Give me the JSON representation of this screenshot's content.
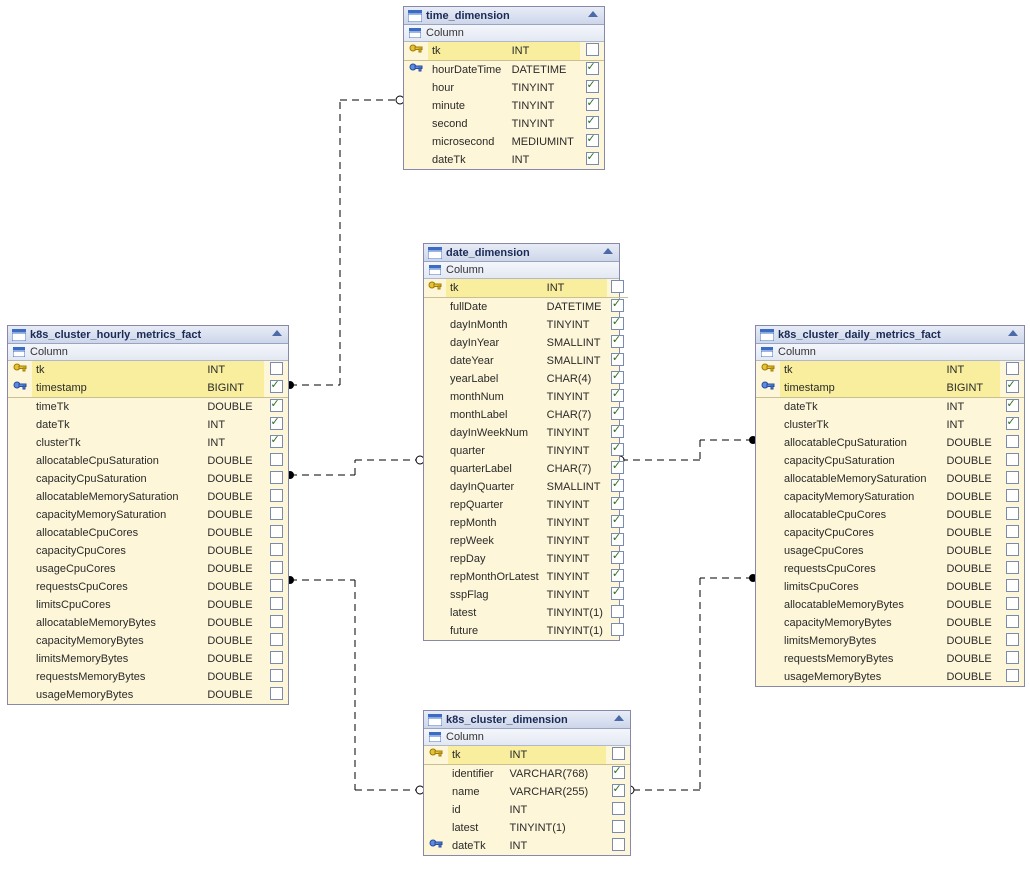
{
  "column_header": "Column",
  "tables": {
    "time_dimension": {
      "title": "time_dimension",
      "cols": [
        {
          "icon": "pk",
          "name": "tk",
          "type": "INT",
          "chk": false
        },
        {
          "icon": "fk",
          "name": "hourDateTime",
          "type": "DATETIME",
          "chk": true
        },
        {
          "icon": "",
          "name": "hour",
          "type": "TINYINT",
          "chk": true
        },
        {
          "icon": "",
          "name": "minute",
          "type": "TINYINT",
          "chk": true
        },
        {
          "icon": "",
          "name": "second",
          "type": "TINYINT",
          "chk": true
        },
        {
          "icon": "",
          "name": "microsecond",
          "type": "MEDIUMINT",
          "chk": true
        },
        {
          "icon": "",
          "name": "dateTk",
          "type": "INT",
          "chk": true
        }
      ]
    },
    "date_dimension": {
      "title": "date_dimension",
      "cols": [
        {
          "icon": "pk",
          "name": "tk",
          "type": "INT",
          "chk": false
        },
        {
          "icon": "",
          "name": "fullDate",
          "type": "DATETIME",
          "chk": true
        },
        {
          "icon": "",
          "name": "dayInMonth",
          "type": "TINYINT",
          "chk": true
        },
        {
          "icon": "",
          "name": "dayInYear",
          "type": "SMALLINT",
          "chk": true
        },
        {
          "icon": "",
          "name": "dateYear",
          "type": "SMALLINT",
          "chk": true
        },
        {
          "icon": "",
          "name": "yearLabel",
          "type": "CHAR(4)",
          "chk": true
        },
        {
          "icon": "",
          "name": "monthNum",
          "type": "TINYINT",
          "chk": true
        },
        {
          "icon": "",
          "name": "monthLabel",
          "type": "CHAR(7)",
          "chk": true
        },
        {
          "icon": "",
          "name": "dayInWeekNum",
          "type": "TINYINT",
          "chk": true
        },
        {
          "icon": "",
          "name": "quarter",
          "type": "TINYINT",
          "chk": true
        },
        {
          "icon": "",
          "name": "quarterLabel",
          "type": "CHAR(7)",
          "chk": true
        },
        {
          "icon": "",
          "name": "dayInQuarter",
          "type": "SMALLINT",
          "chk": true
        },
        {
          "icon": "",
          "name": "repQuarter",
          "type": "TINYINT",
          "chk": true
        },
        {
          "icon": "",
          "name": "repMonth",
          "type": "TINYINT",
          "chk": true
        },
        {
          "icon": "",
          "name": "repWeek",
          "type": "TINYINT",
          "chk": true
        },
        {
          "icon": "",
          "name": "repDay",
          "type": "TINYINT",
          "chk": true
        },
        {
          "icon": "",
          "name": "repMonthOrLatest",
          "type": "TINYINT",
          "chk": true
        },
        {
          "icon": "",
          "name": "sspFlag",
          "type": "TINYINT",
          "chk": true
        },
        {
          "icon": "",
          "name": "latest",
          "type": "TINYINT(1)",
          "chk": false
        },
        {
          "icon": "",
          "name": "future",
          "type": "TINYINT(1)",
          "chk": false
        }
      ]
    },
    "k8s_cluster_dimension": {
      "title": "k8s_cluster_dimension",
      "cols": [
        {
          "icon": "pk",
          "name": "tk",
          "type": "INT",
          "chk": false
        },
        {
          "icon": "",
          "name": "identifier",
          "type": "VARCHAR(768)",
          "chk": true
        },
        {
          "icon": "",
          "name": "name",
          "type": "VARCHAR(255)",
          "chk": true
        },
        {
          "icon": "",
          "name": "id",
          "type": "INT",
          "chk": false
        },
        {
          "icon": "",
          "name": "latest",
          "type": "TINYINT(1)",
          "chk": false
        },
        {
          "icon": "fk",
          "name": "dateTk",
          "type": "INT",
          "chk": false
        }
      ]
    },
    "hourly": {
      "title": "k8s_cluster_hourly_metrics_fact",
      "cols": [
        {
          "icon": "pk",
          "name": "tk",
          "type": "INT",
          "chk": false
        },
        {
          "icon": "fk",
          "name": "timestamp",
          "type": "BIGINT",
          "chk": true
        },
        {
          "icon": "",
          "name": "timeTk",
          "type": "DOUBLE",
          "chk": true
        },
        {
          "icon": "",
          "name": "dateTk",
          "type": "INT",
          "chk": true
        },
        {
          "icon": "",
          "name": "clusterTk",
          "type": "INT",
          "chk": true
        },
        {
          "icon": "",
          "name": "allocatableCpuSaturation",
          "type": "DOUBLE",
          "chk": false
        },
        {
          "icon": "",
          "name": "capacityCpuSaturation",
          "type": "DOUBLE",
          "chk": false
        },
        {
          "icon": "",
          "name": "allocatableMemorySaturation",
          "type": "DOUBLE",
          "chk": false
        },
        {
          "icon": "",
          "name": "capacityMemorySaturation",
          "type": "DOUBLE",
          "chk": false
        },
        {
          "icon": "",
          "name": "allocatableCpuCores",
          "type": "DOUBLE",
          "chk": false
        },
        {
          "icon": "",
          "name": "capacityCpuCores",
          "type": "DOUBLE",
          "chk": false
        },
        {
          "icon": "",
          "name": "usageCpuCores",
          "type": "DOUBLE",
          "chk": false
        },
        {
          "icon": "",
          "name": "requestsCpuCores",
          "type": "DOUBLE",
          "chk": false
        },
        {
          "icon": "",
          "name": "limitsCpuCores",
          "type": "DOUBLE",
          "chk": false
        },
        {
          "icon": "",
          "name": "allocatableMemoryBytes",
          "type": "DOUBLE",
          "chk": false
        },
        {
          "icon": "",
          "name": "capacityMemoryBytes",
          "type": "DOUBLE",
          "chk": false
        },
        {
          "icon": "",
          "name": "limitsMemoryBytes",
          "type": "DOUBLE",
          "chk": false
        },
        {
          "icon": "",
          "name": "requestsMemoryBytes",
          "type": "DOUBLE",
          "chk": false
        },
        {
          "icon": "",
          "name": "usageMemoryBytes",
          "type": "DOUBLE",
          "chk": false
        }
      ]
    },
    "daily": {
      "title": "k8s_cluster_daily_metrics_fact",
      "cols": [
        {
          "icon": "pk",
          "name": "tk",
          "type": "INT",
          "chk": false
        },
        {
          "icon": "fk",
          "name": "timestamp",
          "type": "BIGINT",
          "chk": true
        },
        {
          "icon": "",
          "name": "dateTk",
          "type": "INT",
          "chk": true
        },
        {
          "icon": "",
          "name": "clusterTk",
          "type": "INT",
          "chk": true
        },
        {
          "icon": "",
          "name": "allocatableCpuSaturation",
          "type": "DOUBLE",
          "chk": false
        },
        {
          "icon": "",
          "name": "capacityCpuSaturation",
          "type": "DOUBLE",
          "chk": false
        },
        {
          "icon": "",
          "name": "allocatableMemorySaturation",
          "type": "DOUBLE",
          "chk": false
        },
        {
          "icon": "",
          "name": "capacityMemorySaturation",
          "type": "DOUBLE",
          "chk": false
        },
        {
          "icon": "",
          "name": "allocatableCpuCores",
          "type": "DOUBLE",
          "chk": false
        },
        {
          "icon": "",
          "name": "capacityCpuCores",
          "type": "DOUBLE",
          "chk": false
        },
        {
          "icon": "",
          "name": "usageCpuCores",
          "type": "DOUBLE",
          "chk": false
        },
        {
          "icon": "",
          "name": "requestsCpuCores",
          "type": "DOUBLE",
          "chk": false
        },
        {
          "icon": "",
          "name": "limitsCpuCores",
          "type": "DOUBLE",
          "chk": false
        },
        {
          "icon": "",
          "name": "allocatableMemoryBytes",
          "type": "DOUBLE",
          "chk": false
        },
        {
          "icon": "",
          "name": "capacityMemoryBytes",
          "type": "DOUBLE",
          "chk": false
        },
        {
          "icon": "",
          "name": "limitsMemoryBytes",
          "type": "DOUBLE",
          "chk": false
        },
        {
          "icon": "",
          "name": "requestsMemoryBytes",
          "type": "DOUBLE",
          "chk": false
        },
        {
          "icon": "",
          "name": "usageMemoryBytes",
          "type": "DOUBLE",
          "chk": false
        }
      ]
    }
  }
}
